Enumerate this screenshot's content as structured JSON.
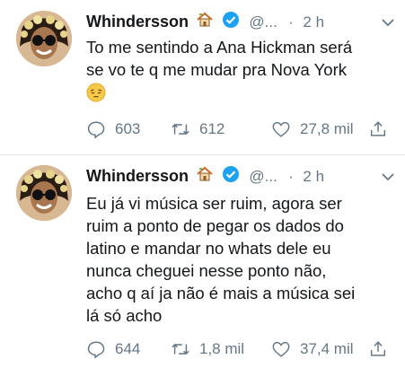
{
  "tweets": [
    {
      "name": "Whindersson",
      "handle": "@...",
      "separator": "·",
      "time": "2 h",
      "text_lines": [
        "To me sentindo a Ana Hickman será",
        "se vo te q me mudar pra Nova York"
      ],
      "emoji": "pensive-face-emoji",
      "replies": "603",
      "retweets": "612",
      "likes": "27,8 mil"
    },
    {
      "name": "Whindersson",
      "handle": "@...",
      "separator": "·",
      "time": "2 h",
      "text_lines": [
        "Eu já vi música ser ruim, agora ser",
        "ruim a ponto de pegar os dados do",
        "latino e mandar no whats dele eu",
        "nunca cheguei nesse ponto não,",
        "acho q aí ja não é mais a música sei",
        "lá só acho"
      ],
      "replies": "644",
      "retweets": "1,8 mil",
      "likes": "37,4 mil"
    }
  ],
  "colors": {
    "text": "#14171a",
    "muted": "#657786",
    "verified": "#1da1f2",
    "divider": "#e1e8ed"
  },
  "icons": [
    "house-emoji",
    "verified-badge-icon",
    "caret-down-icon",
    "reply-icon",
    "retweet-icon",
    "like-icon",
    "share-icon"
  ]
}
